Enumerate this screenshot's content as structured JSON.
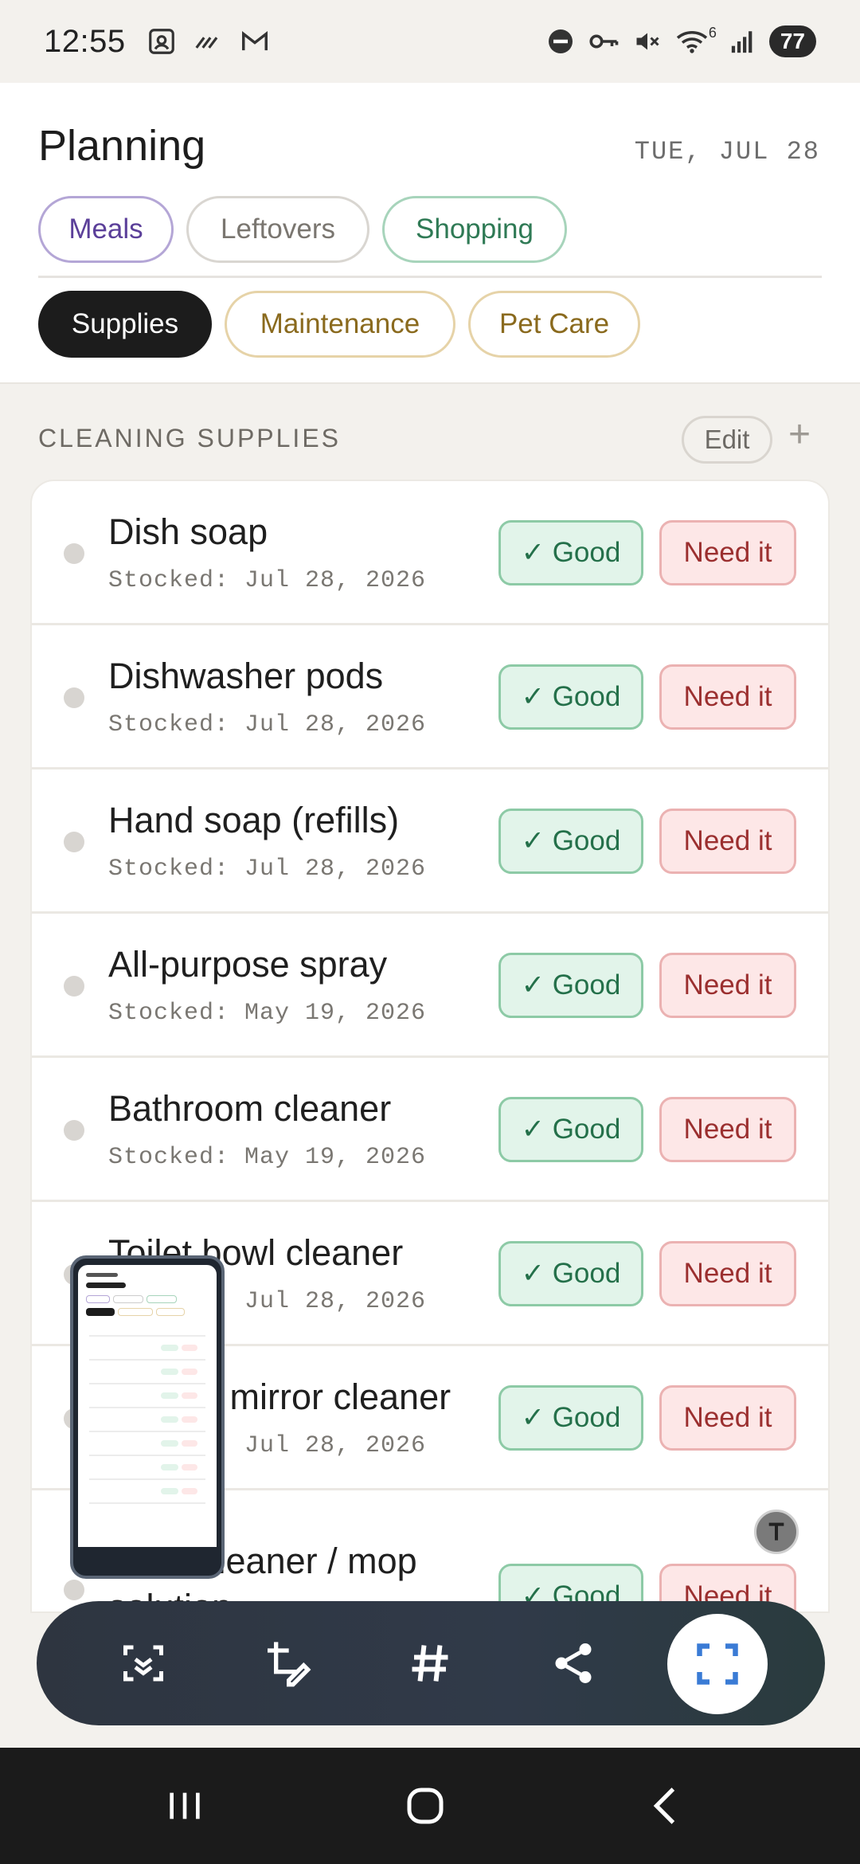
{
  "status_bar": {
    "time": "12:55",
    "left_icons": [
      "screenshot-icon",
      "signal-slash-icon",
      "gmail-icon"
    ],
    "right_icons": [
      "dnd-icon",
      "vpn-key-icon",
      "mute-icon",
      "wifi-icon",
      "cell-signal-icon"
    ],
    "wifi_badge": "6",
    "battery": "77"
  },
  "header": {
    "title": "Planning",
    "date": "TUE, JUL 28",
    "tabs_row1": [
      {
        "label": "Meals",
        "color": "#5b3f99"
      },
      {
        "label": "Leftovers",
        "color": "#7a7670"
      },
      {
        "label": "Shopping",
        "color": "#2f7a55"
      }
    ],
    "tabs_row2": [
      {
        "label": "Supplies",
        "selected": true
      },
      {
        "label": "Maintenance",
        "color": "#8a6a1e"
      },
      {
        "label": "Pet Care",
        "color": "#8a6a1e"
      }
    ]
  },
  "section": {
    "title": "CLEANING SUPPLIES",
    "edit_label": "Edit",
    "add_label": "+"
  },
  "buttons": {
    "good_label": "✓ Good",
    "need_label": "Need it"
  },
  "items": [
    {
      "name": "Dish soap",
      "date": "Stocked: Jul 28, 2026"
    },
    {
      "name": "Dishwasher pods",
      "date": "Stocked: Jul 28, 2026"
    },
    {
      "name": "Hand soap (refills)",
      "date": "Stocked: Jul 28, 2026"
    },
    {
      "name": "All-purpose spray",
      "date": "Stocked: May 19, 2026"
    },
    {
      "name": "Bathroom cleaner",
      "date": "Stocked: May 19, 2026"
    },
    {
      "name": "Toilet bowl cleaner",
      "date": "Stocked: Jul 28, 2026"
    },
    {
      "name": "Glass / mirror cleaner",
      "date": "Stocked: Jul 28, 2026"
    },
    {
      "name": "Floor cleaner / mop solution",
      "date": ""
    }
  ],
  "toolbar": {
    "icons": [
      "scroll-capture-icon",
      "edit-screenshot-icon",
      "hashtag-icon",
      "share-icon",
      "capture-frame-icon"
    ]
  },
  "navbar": {
    "icons": [
      "recents-icon",
      "home-icon",
      "back-icon"
    ]
  }
}
